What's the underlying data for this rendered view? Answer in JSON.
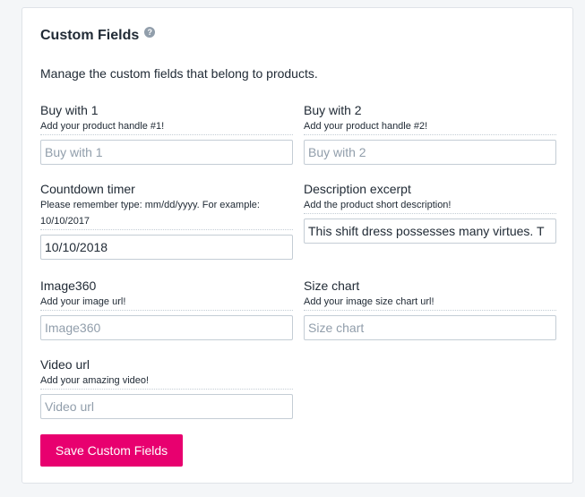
{
  "header": {
    "title": "Custom Fields",
    "help_icon": "question-circle-icon",
    "description": "Manage the custom fields that belong to products."
  },
  "fields": [
    {
      "label": "Buy with 1",
      "hint": "Add your product handle #1!",
      "value": "",
      "placeholder": "Buy with 1"
    },
    {
      "label": "Buy with 2",
      "hint": "Add your product handle #2!",
      "value": "",
      "placeholder": "Buy with 2"
    },
    {
      "label": "Countdown timer",
      "hint": "Please remember type: mm/dd/yyyy. For example: 10/10/2017",
      "value": "10/10/2018",
      "placeholder": ""
    },
    {
      "label": "Description excerpt",
      "hint": "Add the product short description!",
      "value": "This shift dress possesses many virtues. T",
      "placeholder": ""
    },
    {
      "label": "Image360",
      "hint": "Add your image url!",
      "value": "",
      "placeholder": "Image360"
    },
    {
      "label": "Size chart",
      "hint": "Add your image size chart url!",
      "value": "",
      "placeholder": "Size chart"
    },
    {
      "label": "Video url",
      "hint": "Add your amazing video!",
      "value": "",
      "placeholder": "Video url"
    }
  ],
  "actions": {
    "save_label": "Save Custom Fields"
  },
  "colors": {
    "accent": "#e8006f",
    "text": "#212b36",
    "placeholder": "#919eab",
    "border": "#c4cdd5"
  }
}
